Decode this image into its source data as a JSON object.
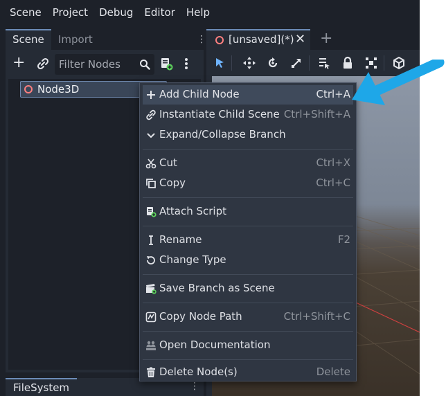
{
  "menubar": [
    "Scene",
    "Project",
    "Debug",
    "Editor",
    "Help"
  ],
  "scene_dock": {
    "tabs": [
      "Scene",
      "Import"
    ],
    "filter_placeholder": "Filter Nodes",
    "tree": {
      "root_label": "Node3D"
    }
  },
  "filesystem_dock": {
    "tab": "FileSystem"
  },
  "editor_tab": {
    "label": "[unsaved](*)",
    "close": "✕",
    "new_tab": "+"
  },
  "context_menu": {
    "items": [
      {
        "label": "Add Child Node",
        "shortcut": "Ctrl+A",
        "icon": "plus-icon",
        "highlighted": true
      },
      {
        "label": "Instantiate Child Scene",
        "shortcut": "Ctrl+Shift+A",
        "icon": "link-icon"
      },
      {
        "label": "Expand/Collapse Branch",
        "shortcut": "",
        "icon": "chevron-down-icon"
      },
      {
        "label": "Cut",
        "shortcut": "Ctrl+X",
        "icon": "scissors-icon"
      },
      {
        "label": "Copy",
        "shortcut": "Ctrl+C",
        "icon": "copy-icon"
      },
      {
        "label": "Attach Script",
        "shortcut": "",
        "icon": "attach-script-icon"
      },
      {
        "label": "Rename",
        "shortcut": "F2",
        "icon": "text-cursor-icon"
      },
      {
        "label": "Change Type",
        "shortcut": "",
        "icon": "rotate-icon"
      },
      {
        "label": "Save Branch as Scene",
        "shortcut": "",
        "icon": "clapperboard-icon"
      },
      {
        "label": "Copy Node Path",
        "shortcut": "Ctrl+Shift+C",
        "icon": "node-path-icon"
      },
      {
        "label": "Open Documentation",
        "shortcut": "",
        "icon": "documentation-icon"
      },
      {
        "label": "Delete Node(s)",
        "shortcut": "Delete",
        "icon": "trash-icon"
      }
    ]
  },
  "colors": {
    "background": "#1d2129",
    "panel": "#252b35",
    "menu": "#2f3642",
    "highlight": "#3f4a5b",
    "accent": "#6c8cb8",
    "node_icon": "#fc7f7f",
    "arrow": "#1ea7e8"
  }
}
